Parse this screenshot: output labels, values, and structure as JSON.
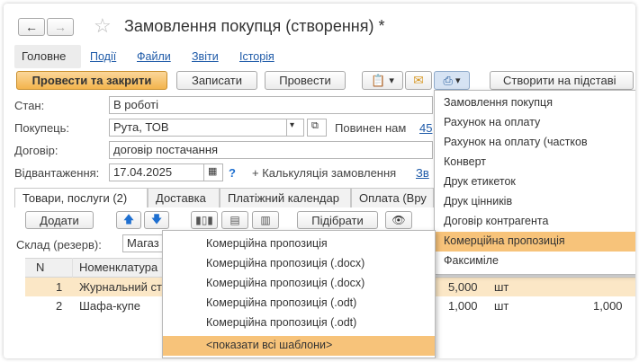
{
  "window": {
    "title": "Замовлення покупця (створення) *"
  },
  "nav_tabs": [
    "Головне",
    "Події",
    "Файли",
    "Звіти",
    "Історія"
  ],
  "toolbar": {
    "post_close": "Провести та закрити",
    "save": "Записати",
    "post": "Провести",
    "create_basis": "Створити на підставі"
  },
  "form": {
    "state_label": "Стан:",
    "state_value": "В роботі",
    "buyer_label": "Покупець:",
    "buyer_value": "Рута, ТОВ",
    "owes_text": "Повинен нам",
    "owes_value": "45",
    "contract_label": "Договір:",
    "contract_value": "договір постачання",
    "shipment_label": "Відвантаження:",
    "shipment_date": "17.04.2025",
    "help": "?",
    "calc_text": "+ Калькуляція замовлення",
    "calc_link": "Зв"
  },
  "doc_tabs": [
    "Товари, послуги (2)",
    "Доставка",
    "Платіжний календар",
    "Оплата (Вру"
  ],
  "table_toolbar": {
    "add": "Додати",
    "pick": "Підібрати"
  },
  "warehouse": {
    "label": "Склад (резерв):",
    "value": "Магаз"
  },
  "table": {
    "headers": {
      "n": "N",
      "item": "Номенклатура"
    },
    "rows": [
      {
        "n": "1",
        "item": "Журнальний ст",
        "qty": "5,000",
        "unit": "шт",
        "extra": ""
      },
      {
        "n": "2",
        "item": "Шафа-купе",
        "qty": "1,000",
        "unit": "шт",
        "extra": "1,000"
      }
    ]
  },
  "print_menu": [
    "Замовлення покупця",
    "Рахунок на оплату",
    "Рахунок на оплату (частков",
    "Конверт",
    "Друк етикеток",
    "Друк цінників",
    "Договір контрагента",
    "Комерційна пропозиція",
    "Факсиміле"
  ],
  "submenu": [
    "Комерційна пропозиція",
    "Комерційна пропозиція (.docx)",
    "Комерційна пропозиція (.docx)",
    "Комерційна пропозиція (.odt)",
    "Комерційна пропозиція (.odt)",
    "<показати всі шаблони>"
  ],
  "colors": {
    "accent": "#f3b44d",
    "highlight": "#f7c37a",
    "link": "#1e5aa8"
  }
}
